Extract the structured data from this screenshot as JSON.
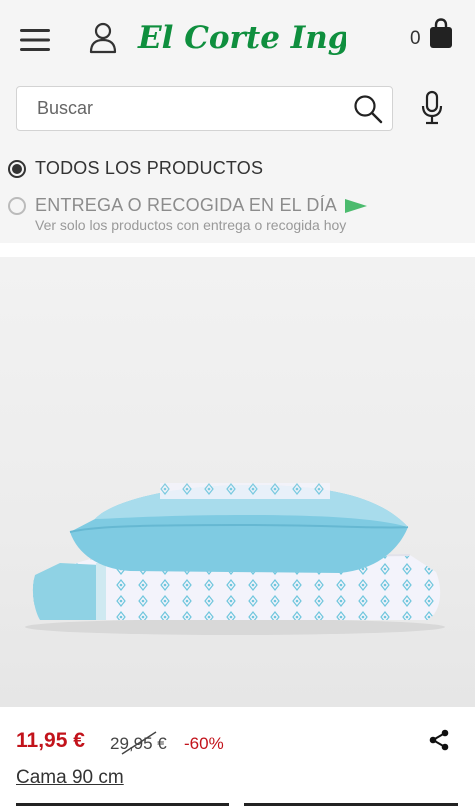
{
  "header": {
    "logo_text": "El Corte Inglés",
    "cart_count": "0"
  },
  "search": {
    "placeholder": "Buscar"
  },
  "filters": {
    "all_products": "TODOS LOS PRODUCTOS",
    "same_day": "ENTREGA O RECOGIDA EN EL DÍA",
    "same_day_sub": "Ver solo los productos con entrega o recogida hoy"
  },
  "product": {
    "price": "11,95 €",
    "old_price": "29,95 €",
    "discount": "-60%",
    "title": "Cama 90 cm"
  },
  "colors": {
    "brand_green": "#0f8f3e",
    "price_red": "#c2131b"
  }
}
